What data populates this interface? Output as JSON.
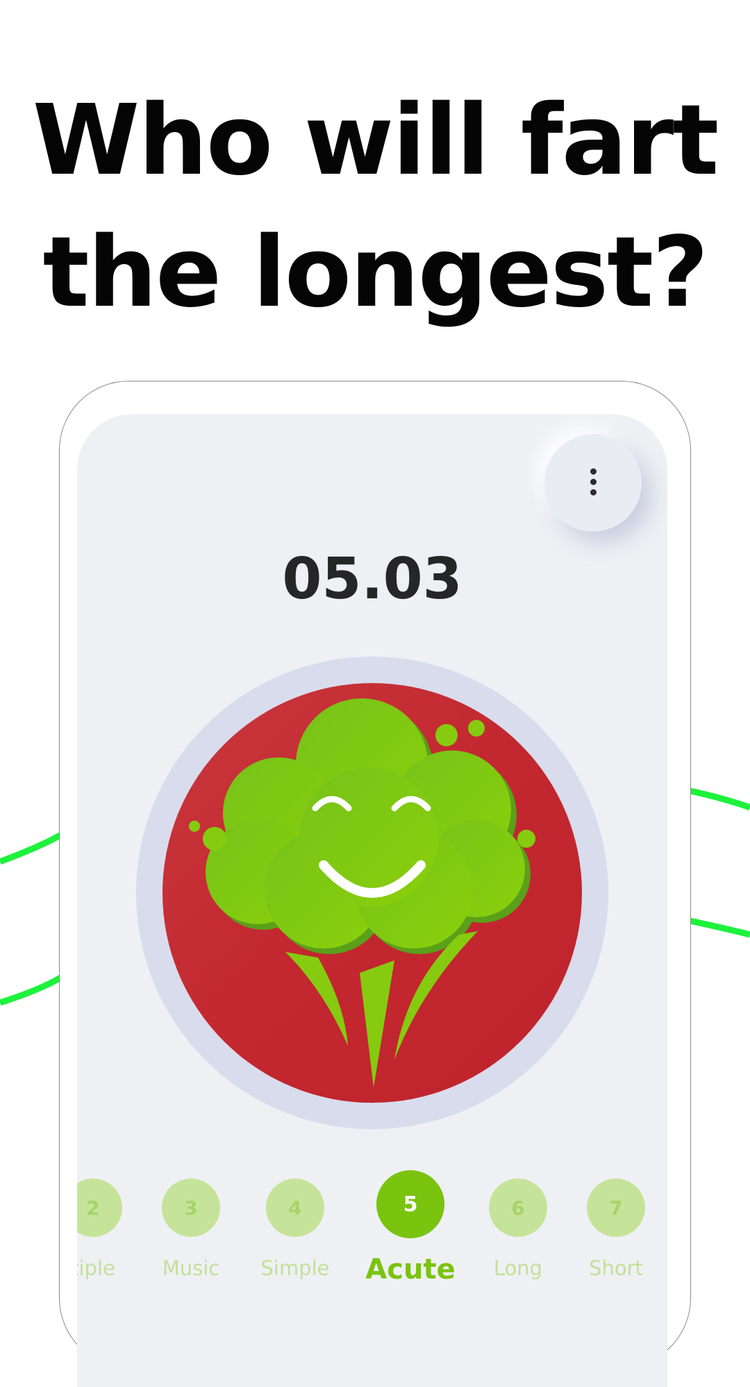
{
  "headline": {
    "line1": "Who will fart",
    "line2": "the longest?"
  },
  "app": {
    "timer": "05.03",
    "menu_icon": "more-vertical-icon",
    "main_button_icon": "smiling-fart-cloud-icon",
    "levels": [
      {
        "number": "2",
        "label": "tiple",
        "active": false
      },
      {
        "number": "3",
        "label": "Music",
        "active": false
      },
      {
        "number": "4",
        "label": "Simple",
        "active": false
      },
      {
        "number": "5",
        "label": "Acute",
        "active": true
      },
      {
        "number": "6",
        "label": "Long",
        "active": false
      },
      {
        "number": "7",
        "label": "Short",
        "active": false
      }
    ]
  },
  "colors": {
    "accent_green": "#7ac30f",
    "button_red": "#c3272f",
    "wave_green": "#1df23c",
    "ring": "#d9dcec",
    "screen_bg": "#eff0f4"
  }
}
